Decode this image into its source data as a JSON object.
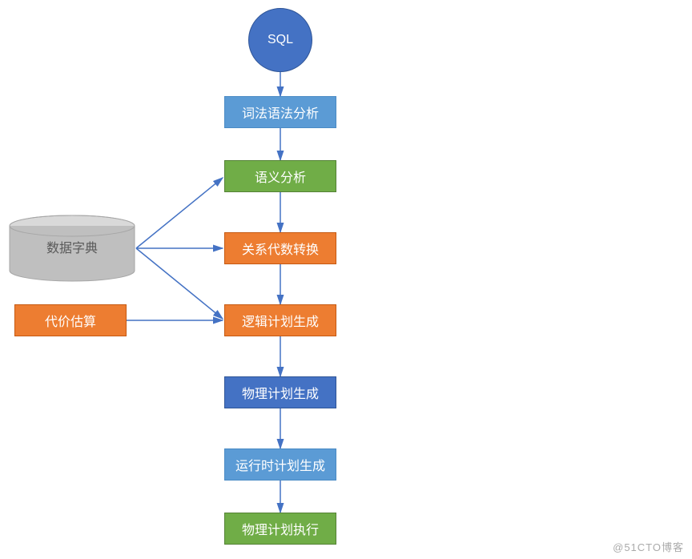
{
  "nodes": {
    "sql": "SQL",
    "lexical": "词法语法分析",
    "semantic": "语义分析",
    "relalg": "关系代数转换",
    "logical": "逻辑计划生成",
    "physical": "物理计划生成",
    "runtime": "运行时计划生成",
    "execute": "物理计划执行",
    "datadict": "数据字典",
    "cost": "代价估算"
  },
  "watermark": "@51CTO博客",
  "colors": {
    "blue": "#5B9BD5",
    "darkblue": "#4472C4",
    "green": "#70AD47",
    "orange": "#ED7D31",
    "gray": "#BFBFBF",
    "arrow": "#4472C4"
  },
  "chart_data": {
    "type": "flowchart",
    "title": "SQL Query Processing Pipeline",
    "nodes": [
      {
        "id": "sql",
        "label": "SQL",
        "shape": "circle",
        "color": "darkblue"
      },
      {
        "id": "lexical",
        "label": "词法语法分析",
        "shape": "rect",
        "color": "blue"
      },
      {
        "id": "semantic",
        "label": "语义分析",
        "shape": "rect",
        "color": "green"
      },
      {
        "id": "relalg",
        "label": "关系代数转换",
        "shape": "rect",
        "color": "orange"
      },
      {
        "id": "logical",
        "label": "逻辑计划生成",
        "shape": "rect",
        "color": "orange"
      },
      {
        "id": "physical",
        "label": "物理计划生成",
        "shape": "rect",
        "color": "darkblue"
      },
      {
        "id": "runtime",
        "label": "运行时计划生成",
        "shape": "rect",
        "color": "blue"
      },
      {
        "id": "execute",
        "label": "物理计划执行",
        "shape": "rect",
        "color": "green"
      },
      {
        "id": "datadict",
        "label": "数据字典",
        "shape": "cylinder",
        "color": "gray"
      },
      {
        "id": "cost",
        "label": "代价估算",
        "shape": "rect",
        "color": "orange"
      }
    ],
    "edges": [
      {
        "from": "sql",
        "to": "lexical"
      },
      {
        "from": "lexical",
        "to": "semantic"
      },
      {
        "from": "semantic",
        "to": "relalg"
      },
      {
        "from": "relalg",
        "to": "logical"
      },
      {
        "from": "logical",
        "to": "physical"
      },
      {
        "from": "physical",
        "to": "runtime"
      },
      {
        "from": "runtime",
        "to": "execute"
      },
      {
        "from": "datadict",
        "to": "semantic"
      },
      {
        "from": "datadict",
        "to": "relalg"
      },
      {
        "from": "datadict",
        "to": "logical"
      },
      {
        "from": "cost",
        "to": "logical"
      }
    ]
  }
}
